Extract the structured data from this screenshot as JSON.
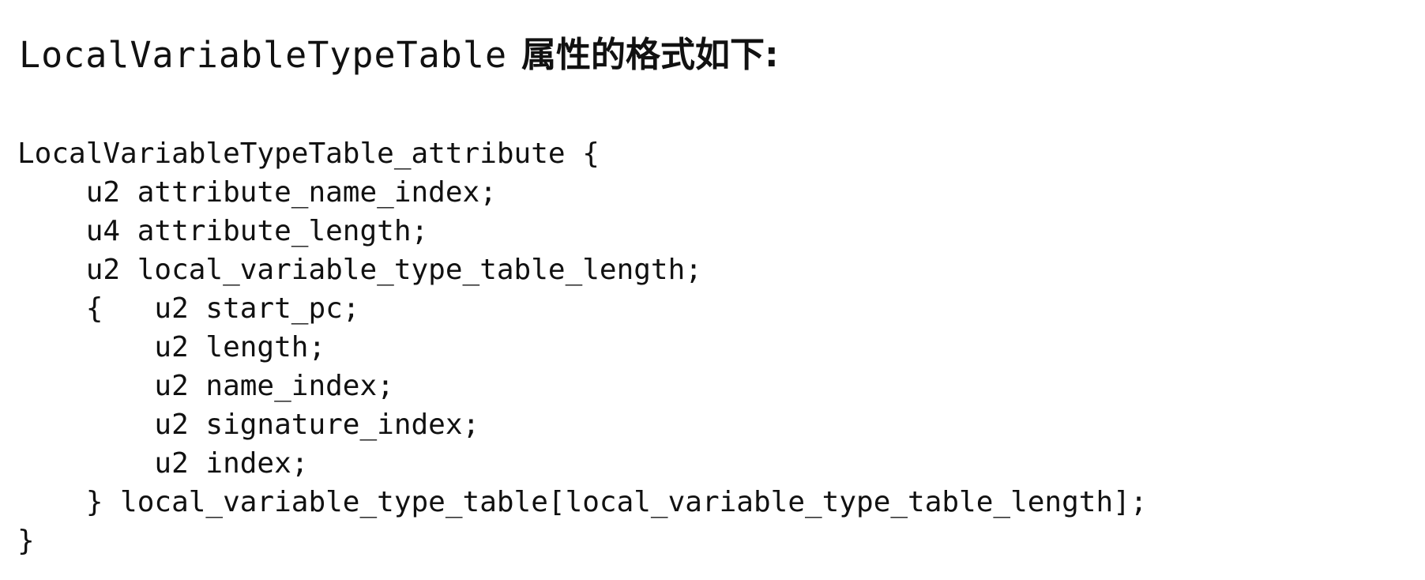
{
  "intro": {
    "code_term": "LocalVariableTypeTable",
    "text": "属性的格式如下:"
  },
  "code_lines": [
    "LocalVariableTypeTable_attribute {",
    "    u2 attribute_name_index;",
    "    u4 attribute_length;",
    "    u2 local_variable_type_table_length;",
    "    {   u2 start_pc;",
    "        u2 length;",
    "        u2 name_index;",
    "        u2 signature_index;",
    "        u2 index;",
    "    } local_variable_type_table[local_variable_type_table_length];",
    "}"
  ]
}
